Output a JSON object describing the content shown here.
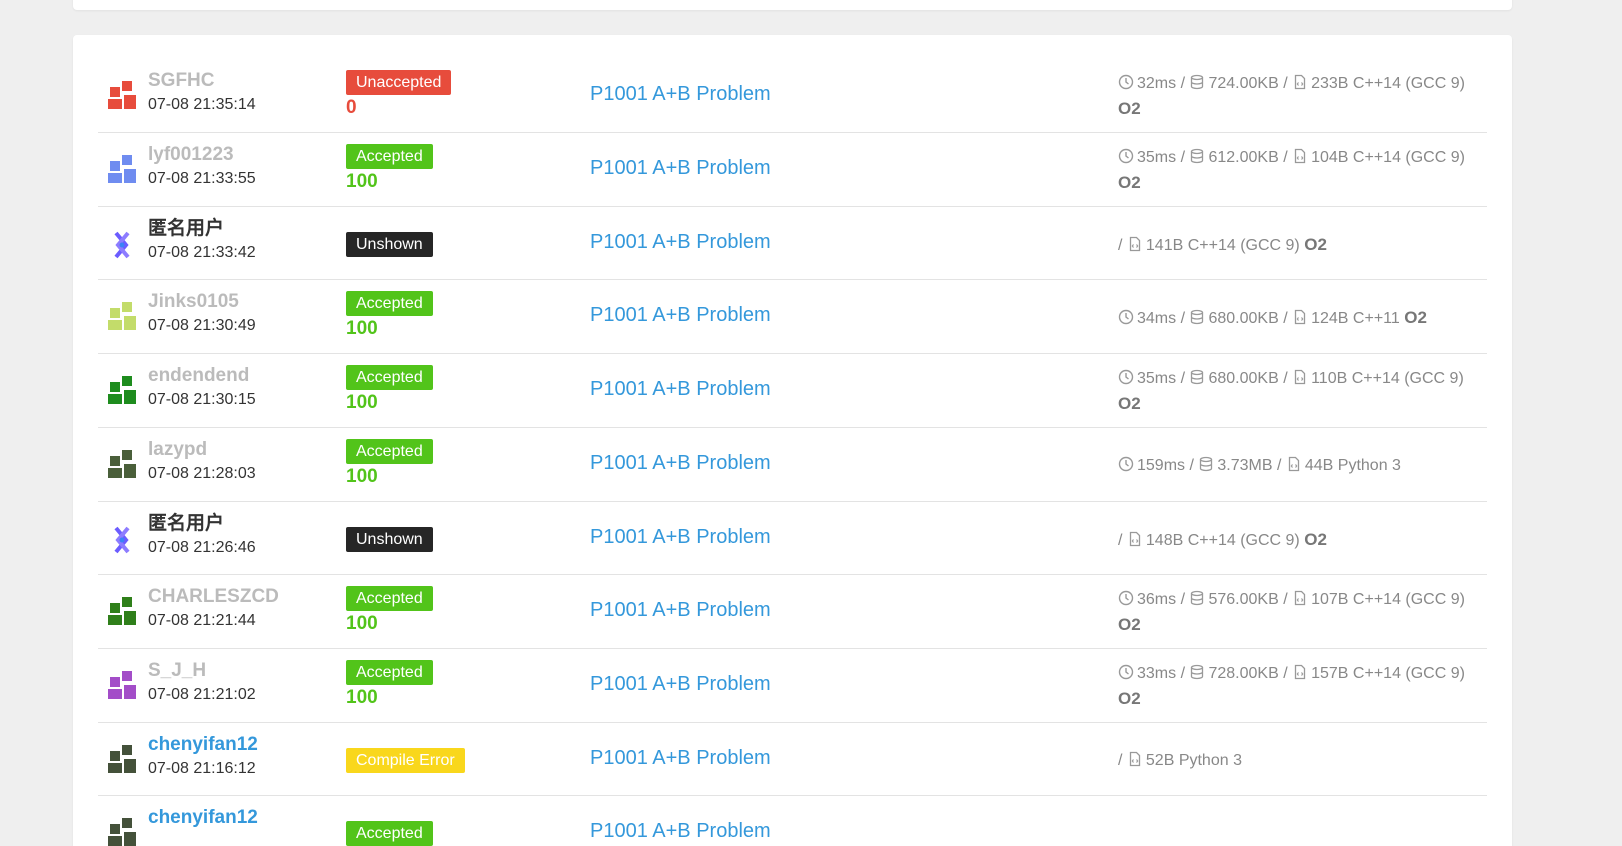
{
  "colors": {
    "accepted": "#52c41a",
    "unaccepted": "#e74c3c",
    "unshown": "#262626",
    "compile_error": "#f9d71c",
    "link": "#3498db"
  },
  "records": [
    {
      "user": "SGFHC",
      "time": "07-08 21:35:14",
      "status": "Unaccepted",
      "score": "0",
      "problem": "P1001 A+B Problem",
      "time_used": "32ms",
      "memory": "724.00KB",
      "code_size": "233B",
      "language": "C++14 (GCC 9)",
      "o2": "O2"
    },
    {
      "user": "lyf001223",
      "time": "07-08 21:33:55",
      "status": "Accepted",
      "score": "100",
      "problem": "P1001 A+B Problem",
      "time_used": "35ms",
      "memory": "612.00KB",
      "code_size": "104B",
      "language": "C++14 (GCC 9)",
      "o2": "O2"
    },
    {
      "user": "匿名用户",
      "time": "07-08 21:33:42",
      "status": "Unshown",
      "score": "",
      "problem": "P1001 A+B Problem",
      "time_used": "",
      "memory": "",
      "code_size": "141B",
      "language": "C++14 (GCC 9)",
      "o2": "O2"
    },
    {
      "user": "Jinks0105",
      "time": "07-08 21:30:49",
      "status": "Accepted",
      "score": "100",
      "problem": "P1001 A+B Problem",
      "time_used": "34ms",
      "memory": "680.00KB",
      "code_size": "124B",
      "language": "C++11",
      "o2": "O2"
    },
    {
      "user": "endendend",
      "time": "07-08 21:30:15",
      "status": "Accepted",
      "score": "100",
      "problem": "P1001 A+B Problem",
      "time_used": "35ms",
      "memory": "680.00KB",
      "code_size": "110B",
      "language": "C++14 (GCC 9)",
      "o2": "O2"
    },
    {
      "user": "lazypd",
      "time": "07-08 21:28:03",
      "status": "Accepted",
      "score": "100",
      "problem": "P1001 A+B Problem",
      "time_used": "159ms",
      "memory": "3.73MB",
      "code_size": "44B",
      "language": "Python 3",
      "o2": ""
    },
    {
      "user": "匿名用户",
      "time": "07-08 21:26:46",
      "status": "Unshown",
      "score": "",
      "problem": "P1001 A+B Problem",
      "time_used": "",
      "memory": "",
      "code_size": "148B",
      "language": "C++14 (GCC 9)",
      "o2": "O2"
    },
    {
      "user": "CHARLESZCD",
      "time": "07-08 21:21:44",
      "status": "Accepted",
      "score": "100",
      "problem": "P1001 A+B Problem",
      "time_used": "36ms",
      "memory": "576.00KB",
      "code_size": "107B",
      "language": "C++14 (GCC 9)",
      "o2": "O2"
    },
    {
      "user": "S_J_H",
      "time": "07-08 21:21:02",
      "status": "Accepted",
      "score": "100",
      "problem": "P1001 A+B Problem",
      "time_used": "33ms",
      "memory": "728.00KB",
      "code_size": "157B",
      "language": "C++14 (GCC 9)",
      "o2": "O2"
    },
    {
      "user": "chenyifan12",
      "time": "07-08 21:16:12",
      "status": "Compile Error",
      "score": "",
      "problem": "P1001 A+B Problem",
      "time_used": "",
      "memory": "",
      "code_size": "52B",
      "language": "Python 3",
      "o2": ""
    },
    {
      "user": "chenyifan12",
      "time": "",
      "status": "Accepted",
      "score": "",
      "problem": "P1001 A+B Problem",
      "time_used": "",
      "memory": "",
      "code_size": "",
      "language": "",
      "o2": ""
    }
  ]
}
